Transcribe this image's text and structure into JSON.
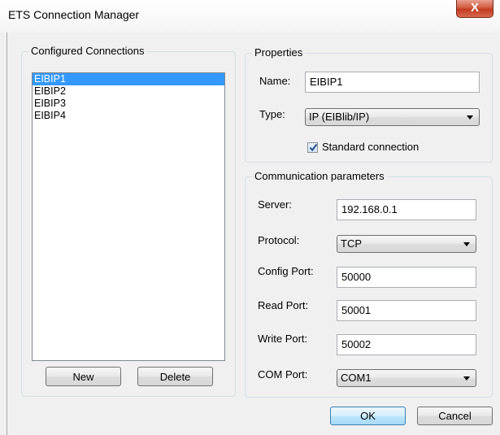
{
  "window": {
    "title": "ETS Connection Manager",
    "close_label": "X"
  },
  "connections": {
    "group_label": "Configured Connections",
    "items": [
      "EIBIP1",
      "EIBIP2",
      "EIBIP3",
      "EIBIP4"
    ],
    "selected_index": 0,
    "new_label": "New",
    "delete_label": "Delete"
  },
  "properties": {
    "group_label": "Properties",
    "name_label": "Name:",
    "name_value": "EIBIP1",
    "type_label": "Type:",
    "type_value": "IP (EIBlib/IP)",
    "standard_label": "Standard connection",
    "standard_checked": true
  },
  "comm": {
    "group_label": "Communication parameters",
    "server_label": "Server:",
    "server_value": "192.168.0.1",
    "protocol_label": "Protocol:",
    "protocol_value": "TCP",
    "config_port_label": "Config Port:",
    "config_port_value": "50000",
    "read_port_label": "Read Port:",
    "read_port_value": "50001",
    "write_port_label": "Write Port:",
    "write_port_value": "50002",
    "com_port_label": "COM Port:",
    "com_port_value": "COM1"
  },
  "footer": {
    "ok_label": "OK",
    "cancel_label": "Cancel"
  },
  "colors": {
    "selection": "#3399ff",
    "dialog_bg": "#f0f0f0",
    "close_red": "#c23b22"
  }
}
